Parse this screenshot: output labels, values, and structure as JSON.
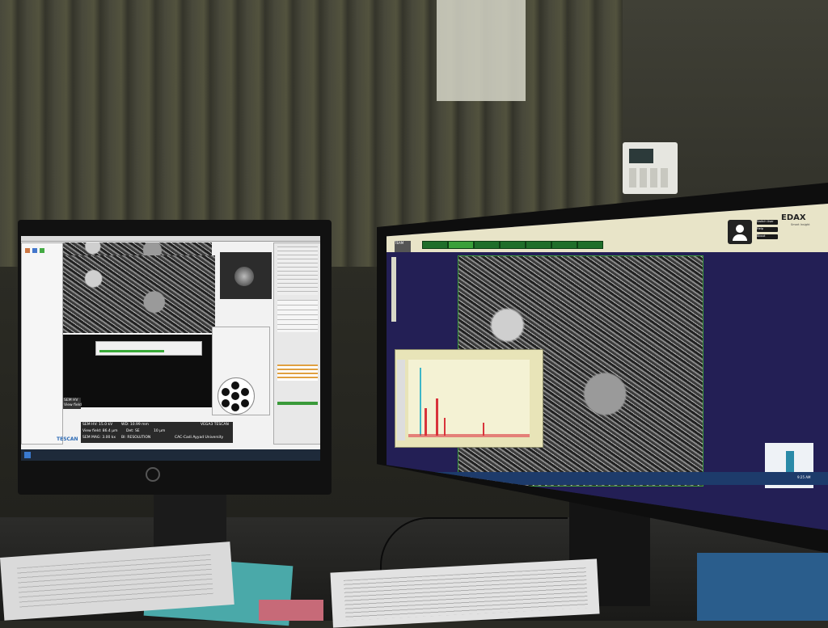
{
  "left_screen": {
    "status_lines": {
      "sem_hv": "SEM HV: 15.0 kV",
      "wd": "WD: 10.99 mm",
      "view_field": "View field: 86.4 µm",
      "det": "Det: SE",
      "scale": "10 µm",
      "sem_mag": "SEM MAG: 3.00 kx",
      "bi": "BI: RESOLUTION",
      "brand": "VEGA3 TESCAN",
      "institution": "CAC-Cadi Ayyad University"
    },
    "side_labels": {
      "sem_hv_small": "SEM HV",
      "view_field_small": "View field"
    },
    "logo_text": "TESCAN"
  },
  "right_screen": {
    "brand": "EDAX",
    "brand_tagline": "Smart Insight",
    "header_buttons": [
      "Switch User",
      "Help",
      "About"
    ],
    "app_logo": "TEAM",
    "clock": "9:25 AM",
    "colors": {
      "header_bg": "#e8e4c8",
      "purple_bg": "#231f55",
      "sem_border": "#3a9a3a",
      "spectrum_red": "#d8343b",
      "spectrum_cyan": "#3db6c7"
    }
  }
}
